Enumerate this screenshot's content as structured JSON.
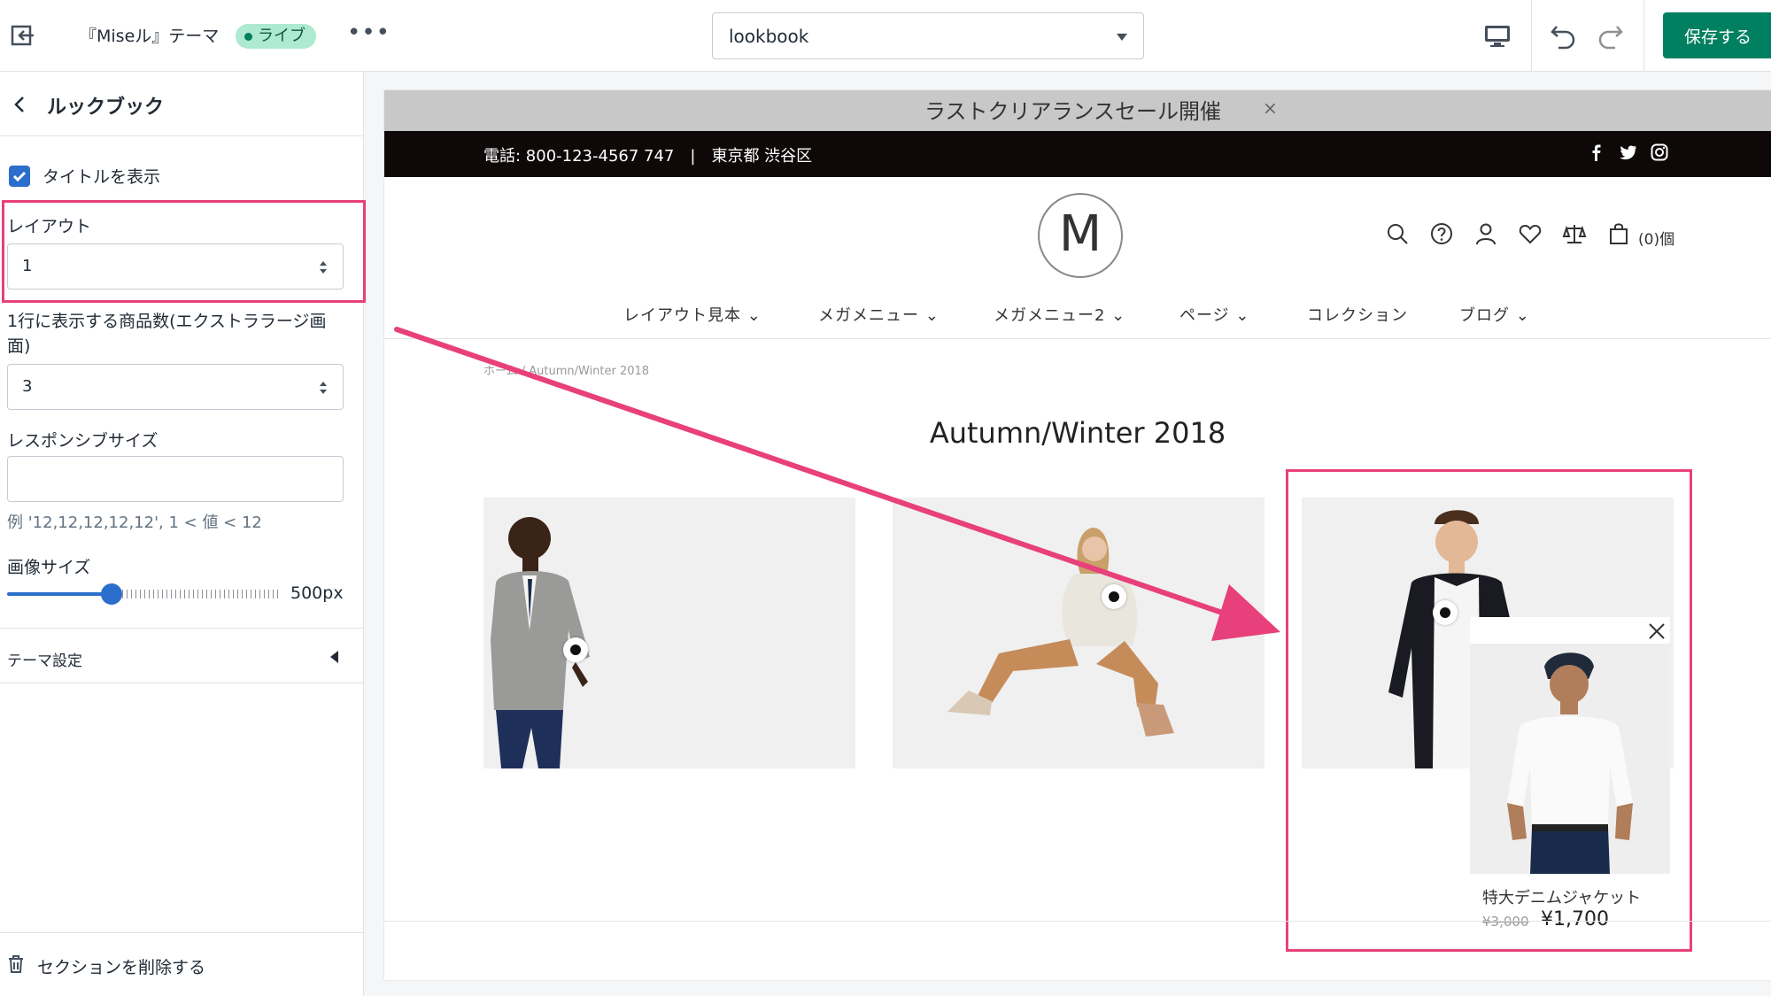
{
  "topbar": {
    "theme_name": "『Miseル』テーマ",
    "live_label": "ライブ",
    "page_select_value": "lookbook",
    "save_label": "保存する"
  },
  "sidebar": {
    "title": "ルックブック",
    "show_title_label": "タイトルを表示",
    "show_title_checked": true,
    "layout_label": "レイアウト",
    "layout_value": "1",
    "per_row_label": "1行に表示する商品数(エクストララージ画面)",
    "per_row_value": "3",
    "responsive_label": "レスポンシブサイズ",
    "responsive_value": "",
    "responsive_help": "例 '12,12,12,12,12', 1 < 値 < 12",
    "image_size_label": "画像サイズ",
    "image_size_value": "500px",
    "image_size_fraction": 0.38,
    "theme_settings_label": "テーマ設定",
    "delete_label": "セクションを削除する"
  },
  "preview": {
    "announcement": "ラストクリアランスセール開催",
    "announcement_close": "×",
    "contact": "電話: 800-123-4567 747　|　東京都 渋谷区",
    "logo_letter": "M",
    "cart_count": "(0)個",
    "nav": [
      "レイアウト見本 ⌄",
      "メガメニュー ⌄",
      "メガメニュー2 ⌄",
      "ページ ⌄",
      "コレクション",
      "ブログ ⌄"
    ],
    "breadcrumb": "ホーム / Autumn/Winter 2018",
    "heading": "Autumn/Winter 2018",
    "popup": {
      "name": "特大デニムジャケット",
      "old_price": "¥3,000",
      "price": "¥1,700"
    }
  },
  "colors": {
    "accent": "#008060",
    "annotation": "#e8407a",
    "checkbox": "#2c6ecb"
  }
}
